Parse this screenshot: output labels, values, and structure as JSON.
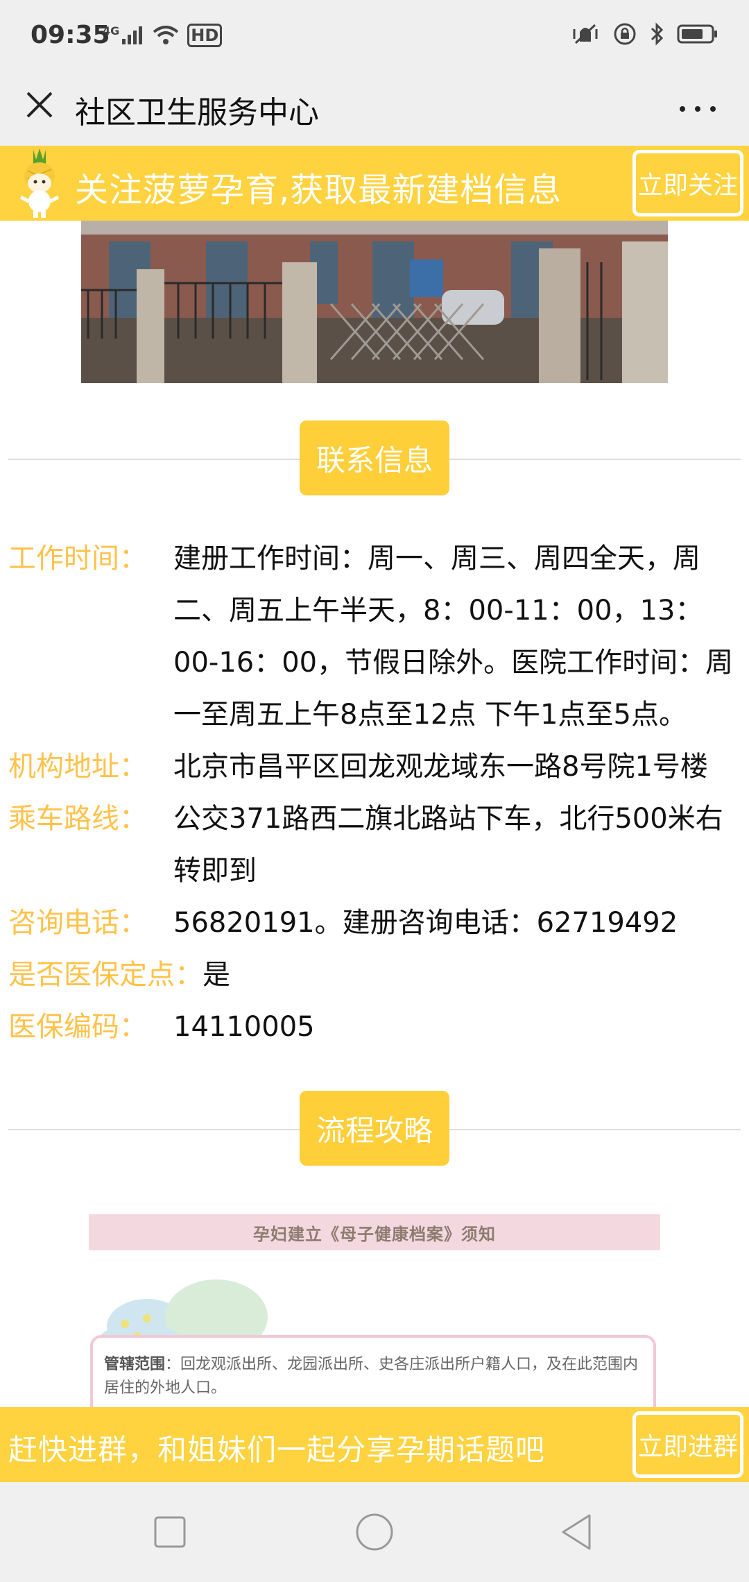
{
  "status_bar": {
    "time": "09:35",
    "network": "4G",
    "hd": "HD"
  },
  "nav": {
    "title": "社区卫生服务中心"
  },
  "follow_banner": {
    "text": "关注菠萝孕育,获取最新建档信息",
    "button": "立即关注"
  },
  "contact_section": {
    "header": "联系信息",
    "rows": [
      {
        "label": "工作时间：",
        "value": "建册工作时间：周一、周三、周四全天，周二、周五上午半天，8：00-11：00，13：00-16：00，节假日除外。医院工作时间：周一至周五上午8点至12点 下午1点至5点。"
      },
      {
        "label": "机构地址：",
        "value": "北京市昌平区回龙观龙域东一路8号院1号楼"
      },
      {
        "label": "乘车路线：",
        "value": "公交371路西二旗北路站下车，北行500米右转即到"
      },
      {
        "label": "咨询电话：",
        "value": "56820191。建册咨询电话：62719492"
      },
      {
        "label": "是否医保定点：",
        "value": "是"
      },
      {
        "label": "医保编码：",
        "value": "14110005"
      }
    ]
  },
  "process_section": {
    "header": "流程攻略"
  },
  "infographic": {
    "title": "孕妇建立《母子健康档案》须知",
    "scope_label": "管辖范围",
    "scope_text": "：回龙观派出所、龙园派出所、史各庄派出所户籍人口，及在此范围内居住的外地人口。"
  },
  "group_banner": {
    "text": "赶快进群，和姐妹们一起分享孕期话题吧",
    "button": "立即进群"
  },
  "colors": {
    "accent_yellow": "#ffd23f",
    "label_yellow": "#ffc24a",
    "section_button": "#ffcf3a"
  }
}
